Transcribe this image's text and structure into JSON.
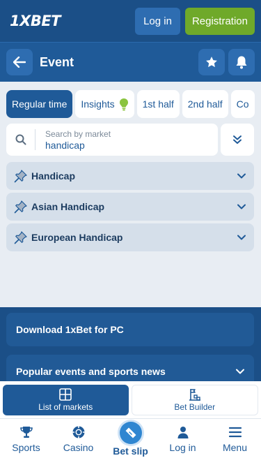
{
  "header": {
    "logo": {
      "part1": "1",
      "part2": "X",
      "part3": "BET"
    },
    "login_label": "Log in",
    "registration_label": "Registration"
  },
  "eventbar": {
    "title": "Event"
  },
  "tabs": [
    {
      "label": "Regular time",
      "active": true
    },
    {
      "label": "Insights",
      "icon": "lightbulb-icon"
    },
    {
      "label": "1st half"
    },
    {
      "label": "2nd half"
    },
    {
      "label": "Co"
    }
  ],
  "search": {
    "placeholder": "Search by market",
    "value": "handicap"
  },
  "markets": [
    {
      "label": "Handicap"
    },
    {
      "label": "Asian Handicap"
    },
    {
      "label": "European Handicap"
    }
  ],
  "lower": {
    "download_label": "Download 1xBet for PC",
    "popular_label": "Popular events and sports news"
  },
  "switcher": {
    "list_label": "List of markets",
    "builder_label": "Bet Builder"
  },
  "bottomnav": {
    "sports": "Sports",
    "casino": "Casino",
    "betslip": "Bet slip",
    "login": "Log in",
    "menu": "Menu"
  },
  "colors": {
    "brand_dark": "#1b4f87",
    "brand": "#1f5a98",
    "accent_green": "#6fa92a",
    "bulb_green": "#8ac43f"
  }
}
